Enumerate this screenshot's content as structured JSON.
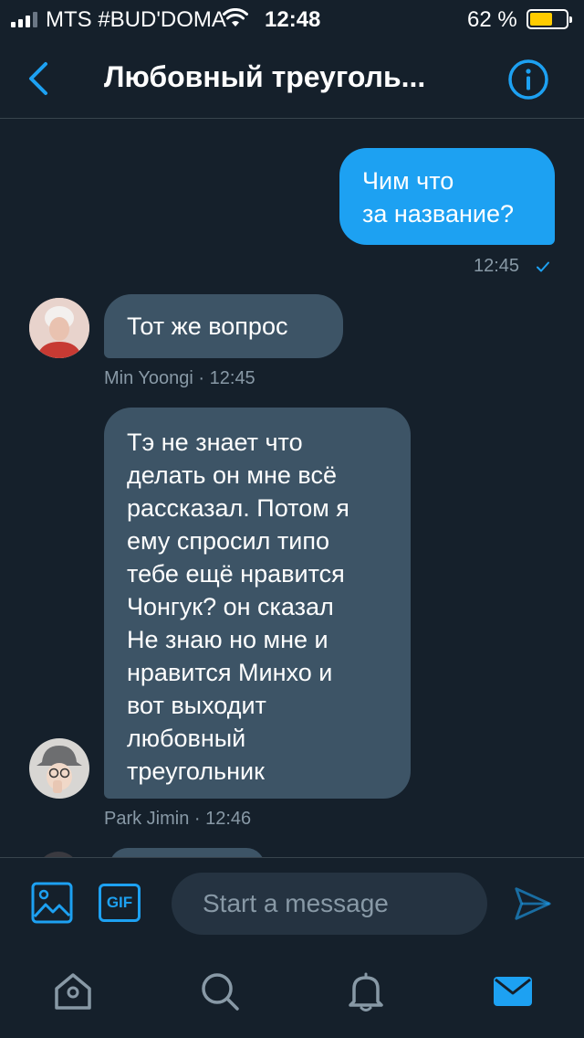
{
  "status_bar": {
    "carrier": "MTS #BUD'DOMA",
    "time": "12:48",
    "battery_percent": "62 %",
    "battery_level": 0.62
  },
  "header": {
    "title": "Любовный треуголь..."
  },
  "messages": [
    {
      "direction": "outgoing",
      "text_lines": [
        "Чим что",
        "за название?"
      ],
      "time": "12:45",
      "status_icon": "check-icon"
    },
    {
      "direction": "incoming",
      "text_lines": [
        "Тот же вопрос"
      ],
      "sender": "Min Yoongi",
      "time": "12:45",
      "meta": "Min Yoongi · 12:45"
    },
    {
      "direction": "incoming",
      "text_lines": [
        "Тэ не знает что",
        "делать он мне всё",
        "рассказал. Потом я",
        "ему спросил типо",
        "тебе ещё нравится",
        "Чонгук? он сказал",
        "Не знаю но мне и",
        "нравится Минхо и",
        "вот выходит",
        "любовный",
        "треугольник"
      ],
      "sender": "Park Jimin",
      "time": "12:46",
      "meta": "Park Jimin · 12:46"
    }
  ],
  "composer": {
    "placeholder": "Start a message",
    "gif_label": "GIF"
  },
  "tabs": [
    {
      "icon": "home-icon",
      "active": false
    },
    {
      "icon": "search-icon",
      "active": false
    },
    {
      "icon": "bell-icon",
      "active": false
    },
    {
      "icon": "mail-icon",
      "active": true
    }
  ],
  "colors": {
    "background": "#15202b",
    "accent": "#1da1f2",
    "incoming_bubble": "#3d5466",
    "muted_text": "#8899a6",
    "battery": "#ffcc00"
  }
}
